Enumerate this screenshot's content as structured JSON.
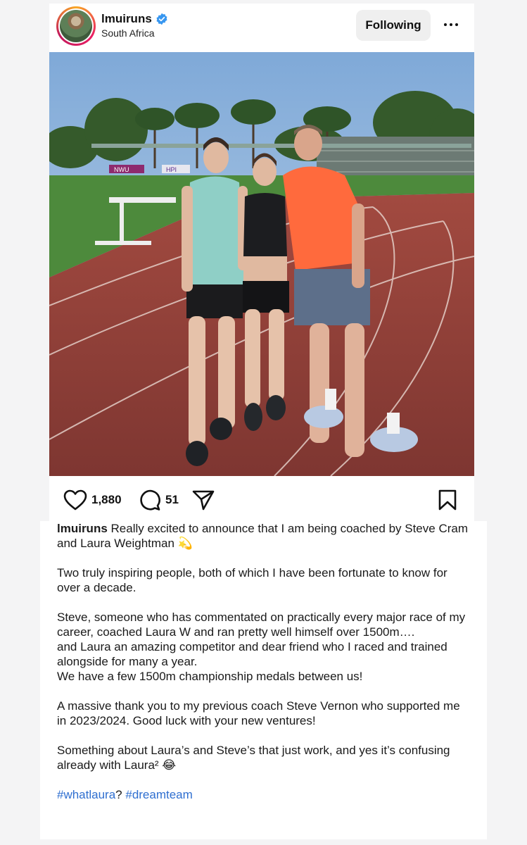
{
  "post": {
    "username": "lmuiruns",
    "location": "South Africa",
    "follow_label": "Following",
    "likes": "1,880",
    "comments": "51"
  },
  "caption": {
    "user": "lmuiruns",
    "line1": "Really excited to announce that I am being coached by Steve Cram and Laura Weightman 💫",
    "para2": "Two truly inspiring people, both of which I have been fortunate to know for over a decade.",
    "para3a": "Steve, someone who has commentated on practically every major race of my career, coached Laura W and ran pretty well himself over 1500m….",
    "para3b": "and Laura an amazing competitor and dear friend who I raced and trained alongside for many a year.",
    "para3c": "We have a few 1500m championship medals between us!",
    "para4": "A massive thank you to my previous coach Steve Vernon who supported me in 2023/2024. Good luck with your new ventures!",
    "para5": "Something about Laura’s and Steve’s that just work, and yes it’s confusing already with Laura² 😂",
    "hashtag1": "#whatlaura",
    "hashtag_sep": "? ",
    "hashtag2": "#dreamteam"
  },
  "photo_signs": {
    "sign1": "NWU",
    "sign2": "HPI"
  },
  "colors": {
    "link": "#2f6fd0",
    "verified": "#3897f0",
    "track": "#8e3f38",
    "sky": "#8fb6e0"
  },
  "icons": [
    "verified-icon",
    "more-options-icon",
    "heart-icon",
    "comment-icon",
    "share-icon",
    "bookmark-icon"
  ]
}
